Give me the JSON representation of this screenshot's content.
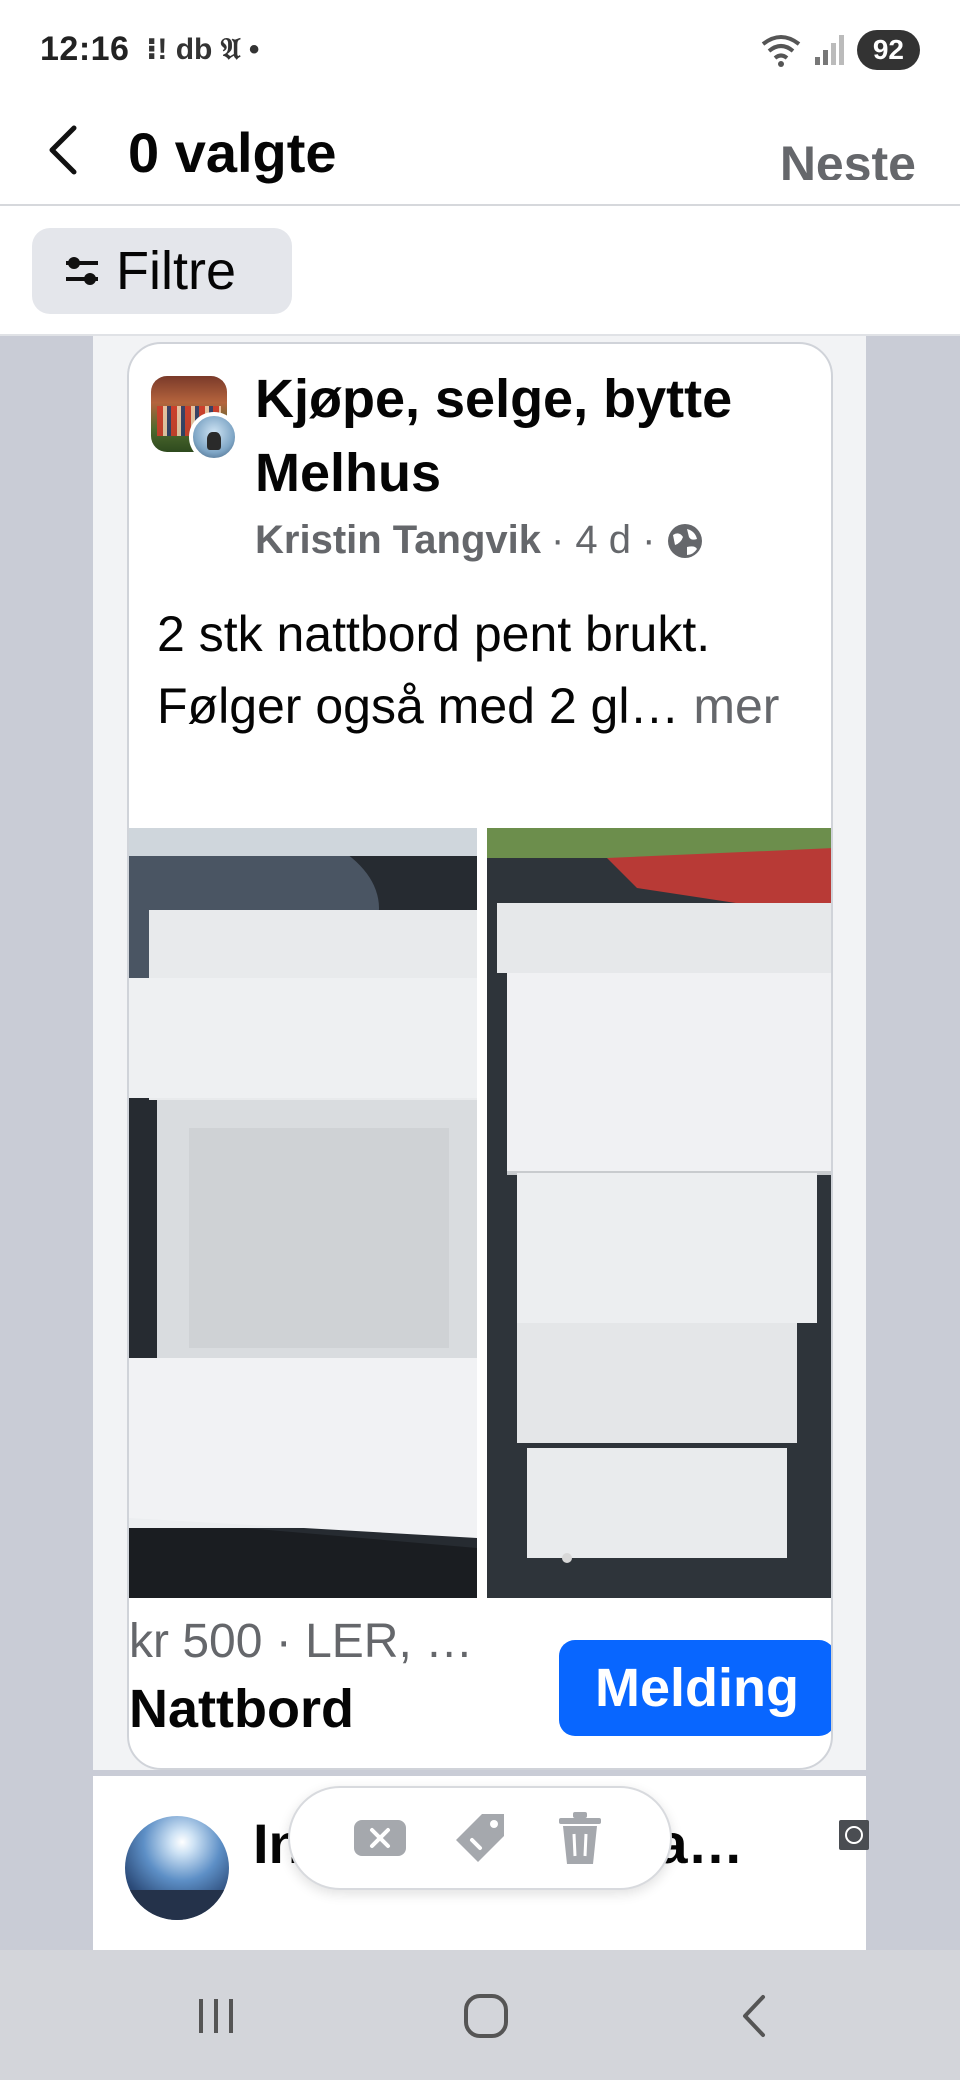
{
  "status_bar": {
    "time": "12:16",
    "notif_icons": "⁝! db 𝔄 •",
    "battery": "92"
  },
  "header": {
    "title": "0 valgte",
    "next_label": "Neste"
  },
  "filter": {
    "label": "Filtre"
  },
  "post": {
    "group_name": "Kjøpe, selge, bytte Melhus",
    "author": "Kristin Tangvik",
    "meta": "· 4 d ·",
    "text": "2 stk nattbord pent brukt. Følger også med 2 gl…",
    "more_label": "mer",
    "price_line": "kr 500 · LER, …",
    "listing_title": "Nattbord",
    "message_label": "Melding"
  },
  "post_2": {
    "name": "Ingrid Håøien Ta…"
  },
  "icons": {
    "back": "chevron-left-icon",
    "filter": "sliders-icon",
    "globe": "globe-icon",
    "pill": [
      "close-tag-icon",
      "price-tag-icon",
      "trash-icon"
    ],
    "nav": [
      "recent-apps-icon",
      "home-icon",
      "back-icon"
    ]
  },
  "colors": {
    "accent": "#0866ff",
    "secondary_text": "#65676b",
    "feed_bg": "#c9ccd6"
  }
}
